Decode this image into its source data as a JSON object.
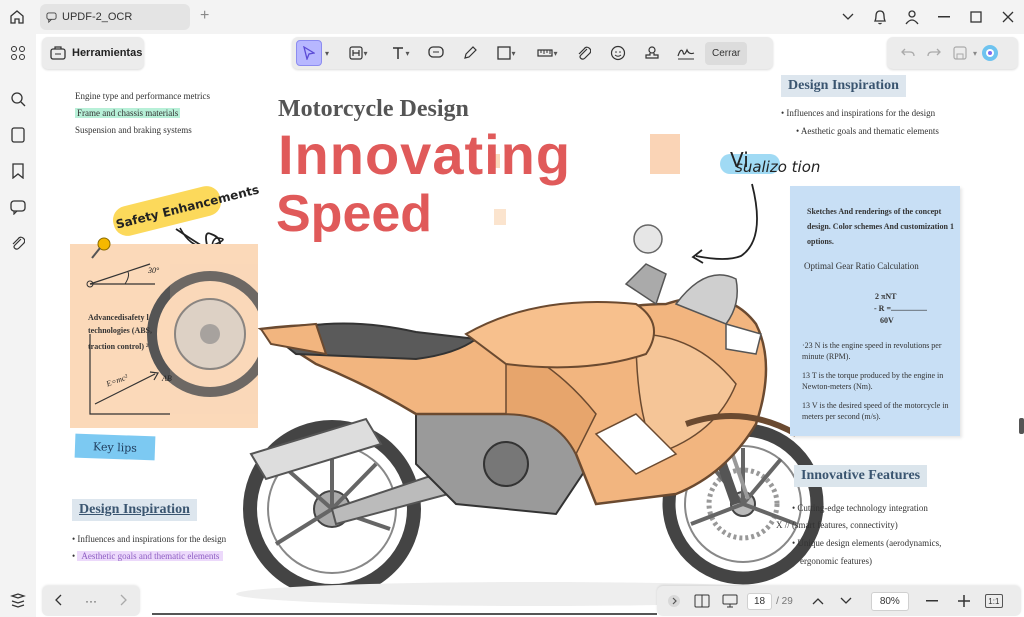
{
  "window": {
    "tab_title": "UPDF-2_OCR",
    "new_tab": "+"
  },
  "toolbar": {
    "tools_label": "Herramientas",
    "close_label": "Cerrar"
  },
  "bottom": {
    "more": "···",
    "current_page": "18",
    "total_pages": "/ 29",
    "zoom": "80%",
    "fit_label": "1:1"
  },
  "document": {
    "left_list": [
      "Engine type and performance metrics",
      "Frame and chassis materials",
      "Suspension and braking systems"
    ],
    "safety_tag": "Safety Enhancements",
    "sticky_left_text_1": "Advancedisafety l",
    "sticky_left_text_2": "technologies (ABS,",
    "sticky_left_text_3": "traction control) ²",
    "angle_label": "30°",
    "formula": "E=mc²",
    "ab_label": "AB",
    "key_tips": "Key lips",
    "design_insp_bottom": "Design Inspiration",
    "bottom_bullets": [
      "Influences and inspirations for the design",
      "Aesthetic goals and thematic elements"
    ],
    "subtitle": "Motorcycle Design",
    "title_1": "Innovating",
    "title_2": "Speed",
    "design_insp_top": "Design Inspiration",
    "top_bullet_1": "• Influences and inspirations for the design",
    "top_bullet_2": "• Aesthetic goals and thematic elements",
    "visualization_1": "Vi",
    "visualization_2": "sualizo tion",
    "sticky_right": {
      "para": "Sketches And renderings of the concept design. Color schemes And customization 1 options.",
      "calc_title": "Optimal Gear Ratio Calculation",
      "formula_1": "2 πNT",
      "formula_2": "-     R =..................",
      "formula_3": "60V",
      "n_def": "·23 N is the engine speed in revolutions per minute (RPM).",
      "t_def": "13 T is the torque produced by the engine in Newton-meters (Nm).",
      "v_def": "13 V is the desired speed of the motorcycle in meters per second (m/s)."
    },
    "innov_features": "Innovative Features",
    "innov_b1": "• Cutting-edge technology integration",
    "innov_b2": "X // (smart features, connectivity)",
    "innov_b3": "• Unique design elements (aerodynamics,",
    "innov_b4": "ergonomic features)"
  },
  "colors": {
    "accent": "#6a5acd",
    "title_red": "#e05a5a",
    "highlight_green": "#b8f0d8",
    "highlight_purple": "#ecd9fb",
    "sticky_peach": "#fbd9b9",
    "sticky_blue": "#c8dff5",
    "bike_orange": "#f2b57f"
  }
}
